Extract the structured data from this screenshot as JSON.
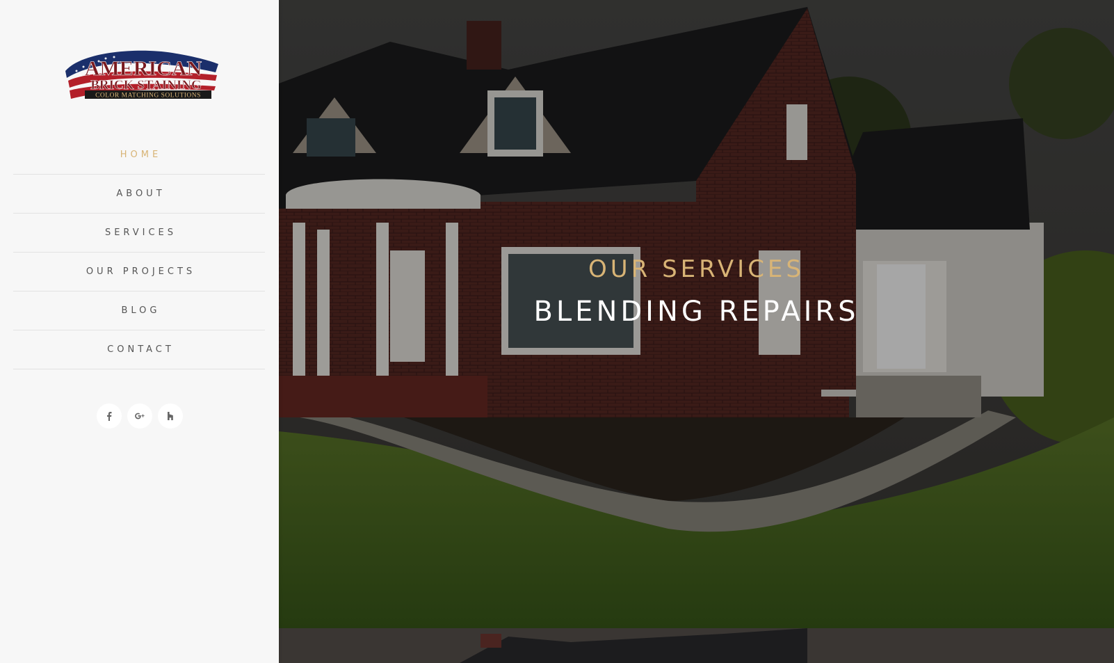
{
  "brand": {
    "logo_line1": "AMERICAN",
    "logo_line2": "BRICK STAINING",
    "logo_line3": "COLOR MATCHING SOLUTIONS"
  },
  "nav": {
    "items": [
      {
        "label": "HOME",
        "active": true
      },
      {
        "label": "ABOUT"
      },
      {
        "label": "SERVICES"
      },
      {
        "label": "OUR PROJECTS"
      },
      {
        "label": "BLOG"
      },
      {
        "label": "CONTACT"
      }
    ]
  },
  "social": {
    "facebook_icon": "f",
    "googleplus_icon": "g+",
    "houzz_icon": "h"
  },
  "hero": {
    "subtitle": "OUR SERVICES",
    "title": "BLENDING REPAIRS"
  },
  "colors": {
    "accent": "#d8b476",
    "sidebar_bg": "#f7f7f7",
    "nav_text": "#555555"
  }
}
